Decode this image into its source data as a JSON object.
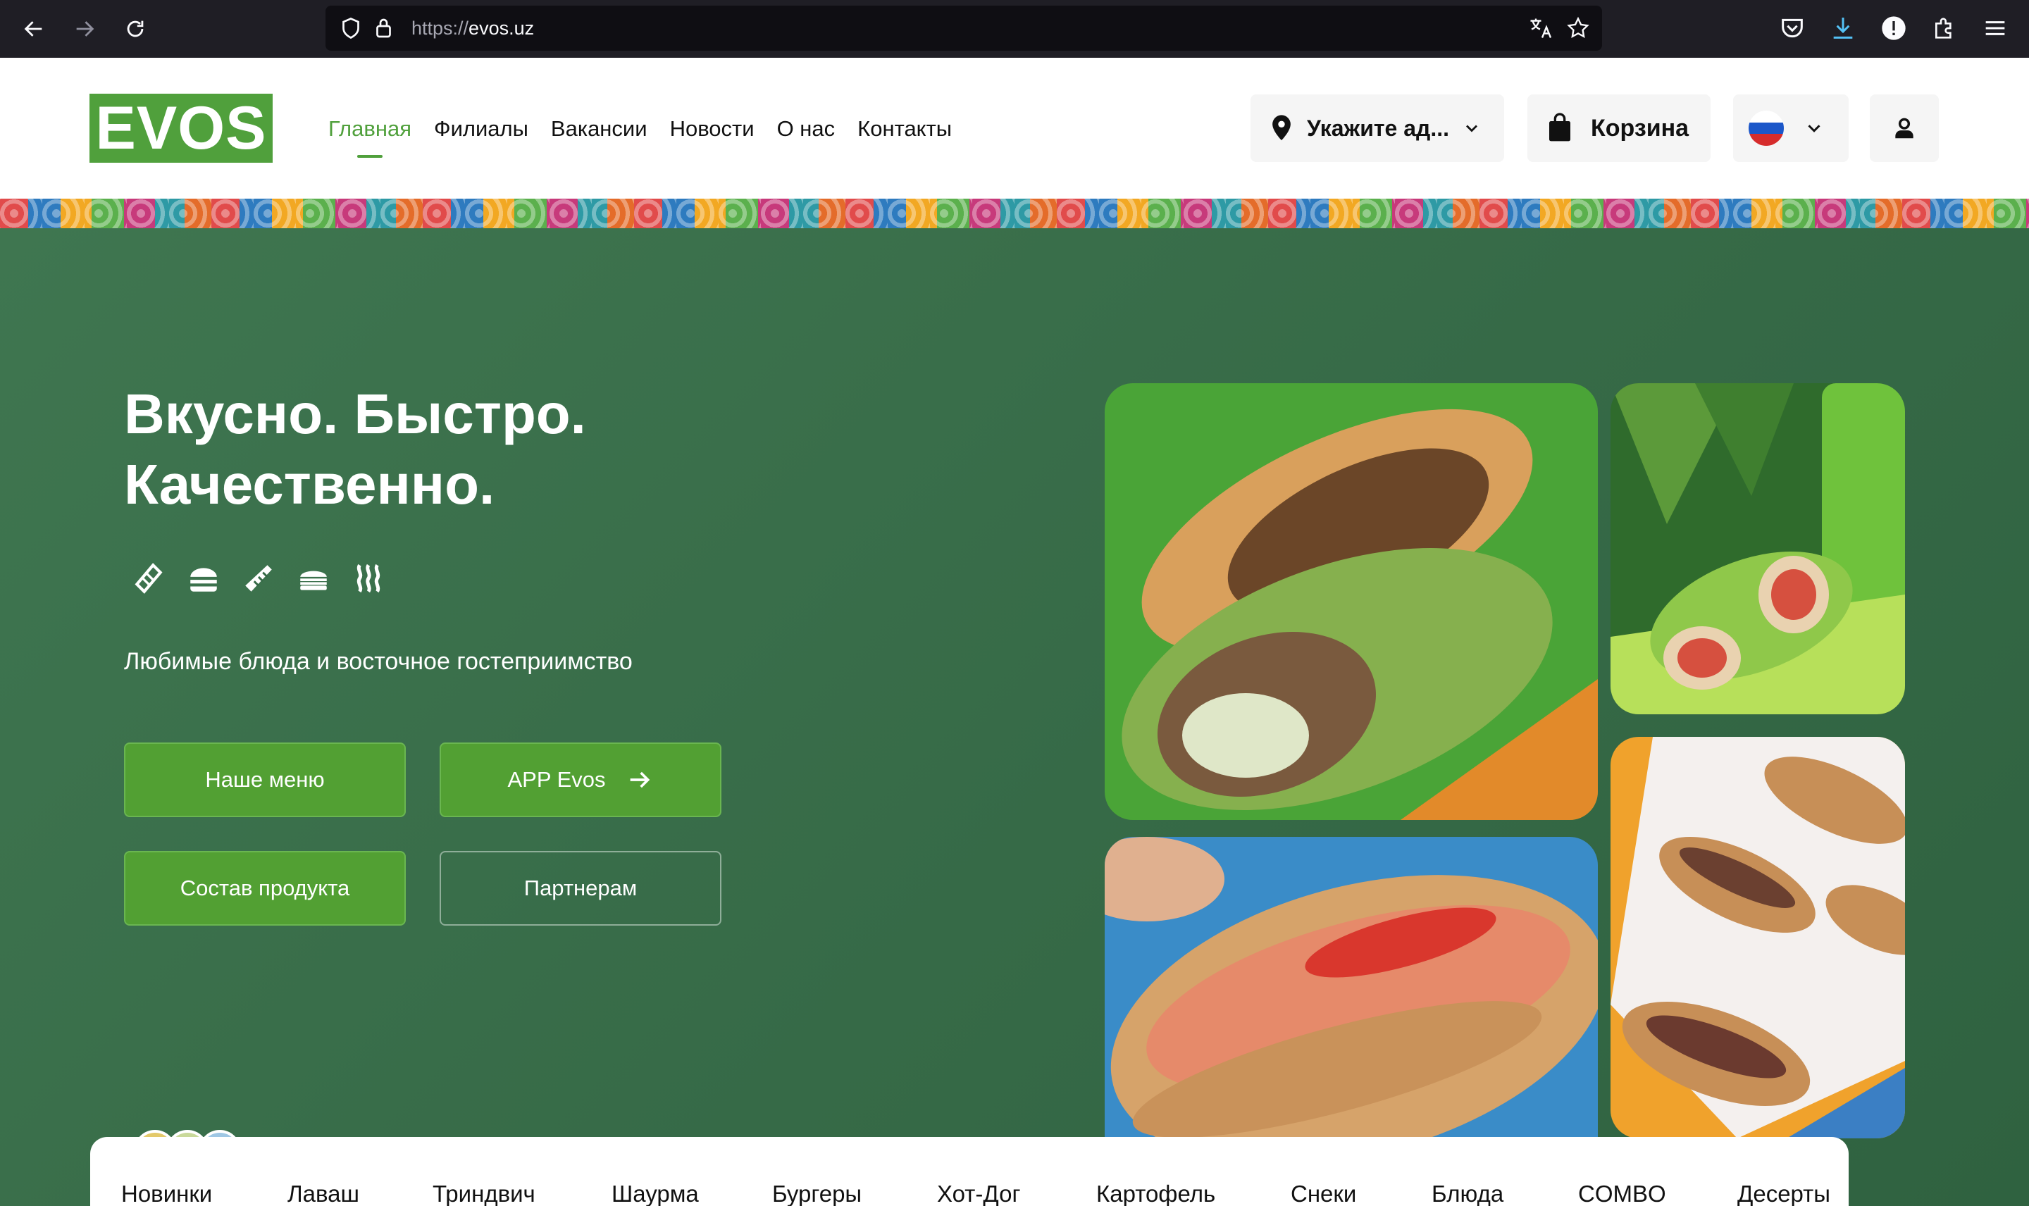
{
  "browser": {
    "url_protocol": "https://",
    "url_host": "evos.uz"
  },
  "header": {
    "logo_text": "EVOS",
    "nav": [
      {
        "label": "Главная",
        "active": true
      },
      {
        "label": "Филиалы",
        "active": false
      },
      {
        "label": "Вакансии",
        "active": false
      },
      {
        "label": "Новости",
        "active": false
      },
      {
        "label": "О нас",
        "active": false
      },
      {
        "label": "Контакты",
        "active": false
      }
    ],
    "address_label": "Укажите ад...",
    "cart_label": "Корзина"
  },
  "hero": {
    "title_line1": "Вкусно. Быстро.",
    "title_line2": "Качественно.",
    "subtitle": "Любимые блюда и восточное гостеприимство",
    "icons": [
      "lavash-icon",
      "burger-icon",
      "shawarma-icon",
      "sandwich-icon",
      "fries-icon"
    ],
    "buttons": {
      "menu": "Наше меню",
      "app": "APP Evos",
      "composition": "Состав продукта",
      "partners": "Партнерам"
    }
  },
  "categories": [
    "Новинки",
    "Лаваш",
    "Триндвич",
    "Шаурма",
    "Бургеры",
    "Хот-Дог",
    "Картофель",
    "Снеки",
    "Блюда",
    "COMBO",
    "Десерты"
  ],
  "colors": {
    "brand_green": "#50a03c",
    "hero_bg": "#3a6e4a",
    "chrome_bg": "#1f1e25"
  }
}
